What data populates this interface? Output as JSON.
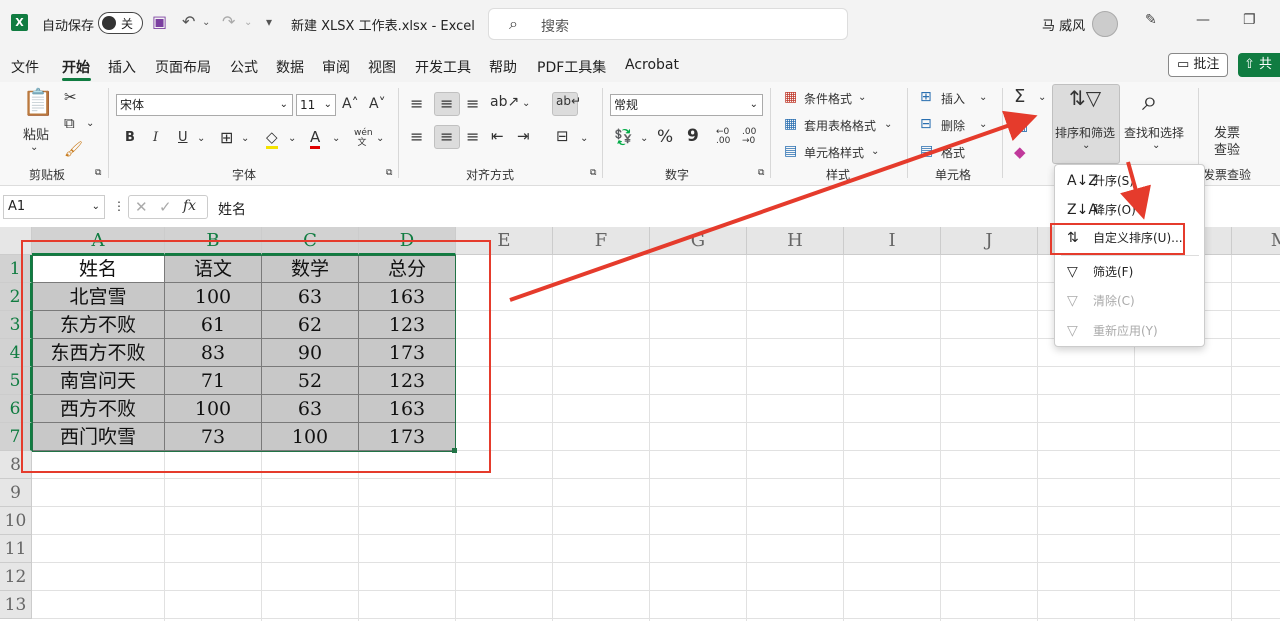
{
  "titlebar": {
    "logo": "X",
    "autosave_label": "自动保存",
    "autosave_state": "关",
    "filename": "新建 XLSX 工作表.xlsx  -  Excel",
    "search_placeholder": "搜索",
    "username": "马 威风"
  },
  "menu": {
    "items": [
      "文件",
      "开始",
      "插入",
      "页面布局",
      "公式",
      "数据",
      "审阅",
      "视图",
      "开发工具",
      "帮助",
      "PDF工具集",
      "Acrobat"
    ],
    "active": "开始",
    "comment_label": "批注",
    "share_label": "共"
  },
  "ribbon": {
    "clipboard": {
      "paste": "粘贴",
      "label": "剪贴板"
    },
    "font": {
      "name": "宋体",
      "size": "11",
      "label": "字体",
      "bold": "B",
      "italic": "I",
      "underline": "U",
      "grow": "A˄",
      "shrink": "A˅",
      "wen": "wén 文"
    },
    "alignment": {
      "label": "对齐方式"
    },
    "number": {
      "format": "常规",
      "label": "数字",
      "percent": "%",
      "comma": "9"
    },
    "styles": {
      "conditional": "条件格式",
      "table": "套用表格格式",
      "cell": "单元格样式",
      "label": "样式"
    },
    "cells": {
      "insert": "插入",
      "delete": "删除",
      "format": "格式",
      "label": "单元格"
    },
    "editing": {
      "sort_filter": "排序和筛选",
      "find_select": "查找和选择"
    },
    "invoice": {
      "check_line1": "发票",
      "check_line2": "查验",
      "label": "发票查验"
    }
  },
  "formula_bar": {
    "cell_ref": "A1",
    "fx": "fx",
    "content": "姓名"
  },
  "grid": {
    "columns": [
      "A",
      "B",
      "C",
      "D",
      "E",
      "F",
      "G",
      "H",
      "I",
      "J",
      "K",
      "L",
      "M"
    ],
    "rows": [
      "1",
      "2",
      "3",
      "4",
      "5",
      "6",
      "7",
      "8",
      "9",
      "10",
      "11",
      "12",
      "13"
    ],
    "table": [
      [
        "姓名",
        "语文",
        "数学",
        "总分"
      ],
      [
        "北宫雪",
        "100",
        "63",
        "163"
      ],
      [
        "东方不败",
        "61",
        "62",
        "123"
      ],
      [
        "东西方不败",
        "83",
        "90",
        "173"
      ],
      [
        "南宫问天",
        "71",
        "52",
        "123"
      ],
      [
        "西方不败",
        "100",
        "63",
        "163"
      ],
      [
        "西门吹雪",
        "73",
        "100",
        "173"
      ]
    ]
  },
  "dropdown": {
    "items": [
      {
        "label": "升序(S)",
        "icon": "sort-ascending-icon",
        "glyph": "A↓Z",
        "enabled": true
      },
      {
        "label": "降序(O)",
        "icon": "sort-descending-icon",
        "glyph": "Z↓A",
        "enabled": true
      },
      {
        "label": "自定义排序(U)...",
        "icon": "custom-sort-icon",
        "glyph": "⇅",
        "enabled": true
      },
      {
        "label": "筛选(F)",
        "icon": "filter-icon",
        "glyph": "▽",
        "enabled": true
      },
      {
        "label": "清除(C)",
        "icon": "clear-filter-icon",
        "glyph": "▽",
        "enabled": false
      },
      {
        "label": "重新应用(Y)",
        "icon": "reapply-icon",
        "glyph": "▽",
        "enabled": false
      }
    ]
  },
  "colors": {
    "accent": "#107c41",
    "annotation": "#e53b2c",
    "cell_fill": "#c8c8c8"
  }
}
